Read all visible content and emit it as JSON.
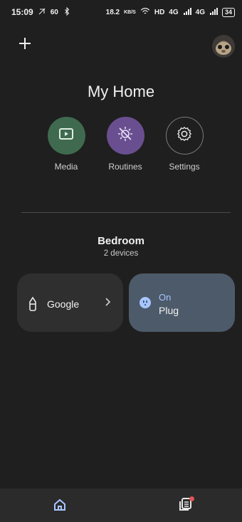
{
  "status_bar": {
    "time": "15:09",
    "left_extra": "60",
    "speed": "18.2",
    "speed_unit": "KB/S",
    "hd": "HD",
    "net1": "4G",
    "net2": "4G",
    "battery": "34"
  },
  "header": {
    "title": "My Home",
    "add_icon": "plus-icon",
    "avatar": "profile-avatar"
  },
  "quick_actions": [
    {
      "label": "Media",
      "icon": "play-icon",
      "bg": "#3f6a4f"
    },
    {
      "label": "Routines",
      "icon": "sun-off-icon",
      "bg": "#6a4f90"
    },
    {
      "label": "Settings",
      "icon": "gear-icon",
      "bg": "#1f1f1f"
    }
  ],
  "room": {
    "name": "Bedroom",
    "subtitle": "2 devices"
  },
  "devices": [
    {
      "name": "Google",
      "icon": "speaker-icon"
    },
    {
      "status": "On",
      "name": "Plug",
      "icon": "outlet-icon"
    }
  ],
  "bottom_nav": [
    {
      "name": "home",
      "icon": "home-icon",
      "active": true
    },
    {
      "name": "feed",
      "icon": "feed-icon",
      "badge": true
    }
  ]
}
